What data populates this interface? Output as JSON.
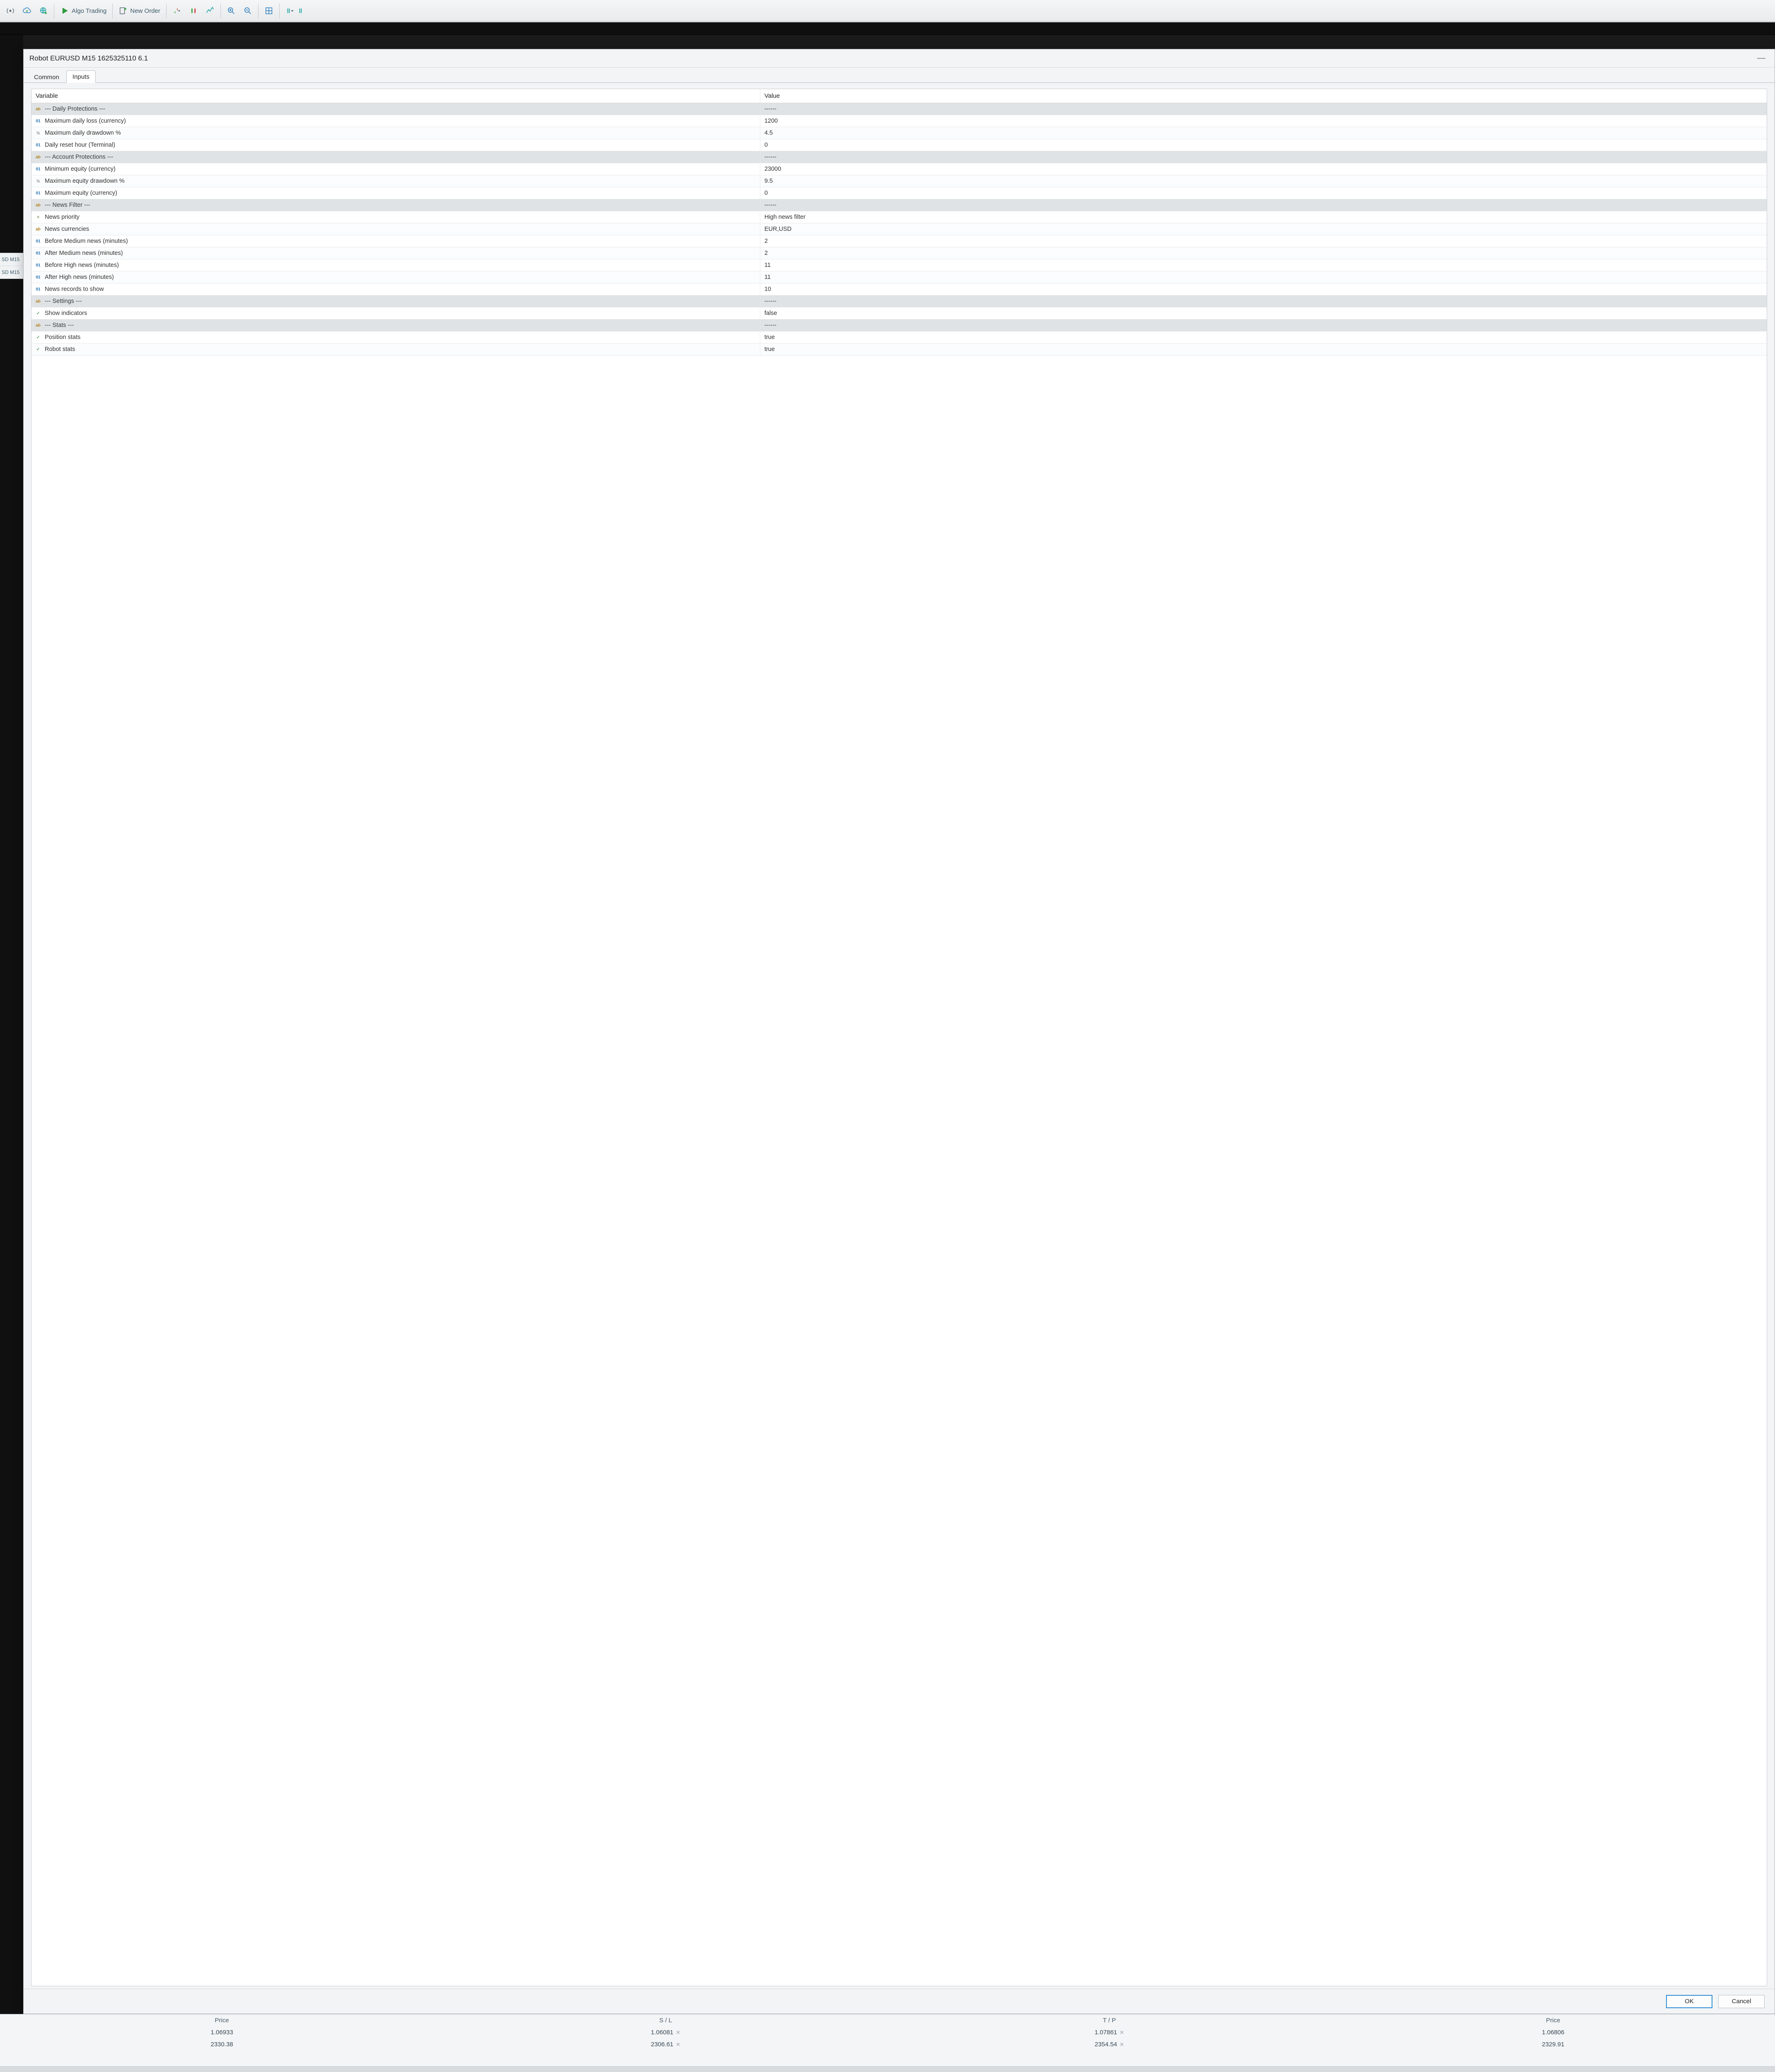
{
  "toolbar": {
    "algo_label": "Algo Trading",
    "new_order_label": "New Order"
  },
  "background_tabs": [
    "SD M15",
    "SD M15"
  ],
  "dialog": {
    "title": "Robot EURUSD M15 1625325110 6.1",
    "tabs": {
      "common": "Common",
      "inputs": "Inputs"
    },
    "grid": {
      "col_variable": "Variable",
      "col_value": "Value"
    },
    "rows": [
      {
        "type": "ab",
        "name": "--- Daily Protections ---",
        "value": "------",
        "section": true
      },
      {
        "type": "int",
        "name": "Maximum daily loss (currency)",
        "value": "1200"
      },
      {
        "type": "pct",
        "name": "Maximum daily drawdown %",
        "value": "4.5"
      },
      {
        "type": "int",
        "name": "Daily reset hour (Terminal)",
        "value": "0"
      },
      {
        "type": "ab",
        "name": "--- Account Protections ---",
        "value": "------",
        "section": true
      },
      {
        "type": "int",
        "name": "Minimum equity (currency)",
        "value": "23000"
      },
      {
        "type": "pct",
        "name": "Maximum equity drawdown %",
        "value": "9.5"
      },
      {
        "type": "int",
        "name": "Maximum equity (currency)",
        "value": "0"
      },
      {
        "type": "ab",
        "name": "--- News Filter ---",
        "value": "------",
        "section": true
      },
      {
        "type": "enum",
        "name": "News priority",
        "value": "High news filter"
      },
      {
        "type": "ab",
        "name": "News currencies",
        "value": "EUR,USD"
      },
      {
        "type": "int",
        "name": "Before Medium news (minutes)",
        "value": "2"
      },
      {
        "type": "int",
        "name": "After Medium news (minutes)",
        "value": "2"
      },
      {
        "type": "int",
        "name": "Before High news (minutes)",
        "value": "11"
      },
      {
        "type": "int",
        "name": "After High news (minutes)",
        "value": "11"
      },
      {
        "type": "int",
        "name": "News records to show",
        "value": "10"
      },
      {
        "type": "ab",
        "name": "--- Settings ---",
        "value": "------",
        "section": true
      },
      {
        "type": "bool",
        "name": "Show indicators",
        "value": "false"
      },
      {
        "type": "ab",
        "name": "--- Stats ---",
        "value": "------",
        "section": true
      },
      {
        "type": "bool",
        "name": "Position stats",
        "value": "true"
      },
      {
        "type": "bool",
        "name": "Robot stats",
        "value": "true"
      }
    ],
    "ok_label": "OK",
    "cancel_label": "Cancel"
  },
  "trade_panel": {
    "headers": {
      "price": "Price",
      "sl": "S / L",
      "tp": "T / P",
      "price2": "Price"
    },
    "rows": [
      {
        "price": "1.06933",
        "sl": "1.06081",
        "tp": "1.07861",
        "price2": "1.06806"
      },
      {
        "price": "2330.38",
        "sl": "2306.61",
        "tp": "2354.54",
        "price2": "2329.91"
      }
    ]
  }
}
